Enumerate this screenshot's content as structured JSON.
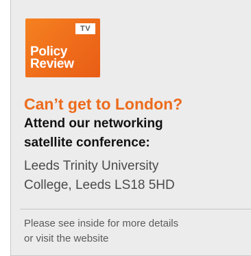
{
  "logo": {
    "badge": "TV",
    "line1": "Policy",
    "line2": "Review"
  },
  "headline": "Can’t get to London?",
  "subhead": {
    "line1": "Attend our networking",
    "line2": "satellite conference:"
  },
  "venue": {
    "line1": "Leeds Trinity University",
    "line2": "College, Leeds LS18 5HD"
  },
  "details": {
    "line1": "Please see inside for more details",
    "line2": "or visit the website"
  },
  "colors": {
    "brand_orange": "#f58220",
    "headline_orange": "#ec6b1c",
    "panel_bg": "#ececec"
  }
}
